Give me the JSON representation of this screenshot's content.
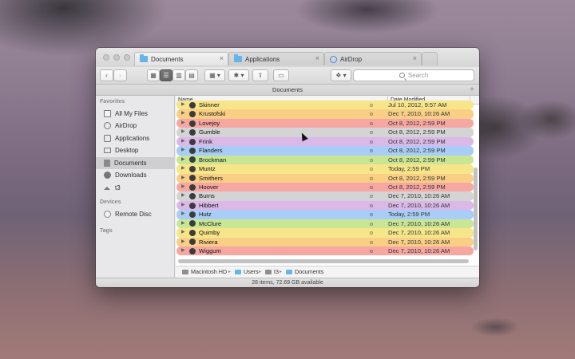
{
  "tabs": [
    {
      "label": "Documents",
      "icon": "folder-icon",
      "active": true
    },
    {
      "label": "Applications",
      "icon": "folder-icon",
      "active": false
    },
    {
      "label": "AirDrop",
      "icon": "airdrop-icon",
      "active": false
    }
  ],
  "toolbar": {
    "search_placeholder": "Search",
    "back_glyph": "‹",
    "forward_glyph": "›"
  },
  "path_header": {
    "title": "Documents"
  },
  "sidebar": {
    "favorites_label": "Favorites",
    "favorites": [
      {
        "label": "All My Files",
        "icon": "all-files-icon"
      },
      {
        "label": "AirDrop",
        "icon": "airdrop-icon"
      },
      {
        "label": "Applications",
        "icon": "applications-icon"
      },
      {
        "label": "Desktop",
        "icon": "desktop-icon"
      },
      {
        "label": "Documents",
        "icon": "documents-icon",
        "selected": true
      },
      {
        "label": "Downloads",
        "icon": "downloads-icon"
      },
      {
        "label": "t3",
        "icon": "home-icon"
      }
    ],
    "devices_label": "Devices",
    "devices": [
      {
        "label": "Remote Disc",
        "icon": "disc-icon"
      }
    ],
    "tags_label": "Tags"
  },
  "columns": {
    "name": "Name",
    "date": "Date Modified"
  },
  "files": [
    {
      "name": "Skinner",
      "date": "Jul 10, 2012, 9:57 AM",
      "color": "#f7e58a"
    },
    {
      "name": "Krustofski",
      "date": "Dec 7, 2010, 10:26 AM",
      "color": "#f9cf86"
    },
    {
      "name": "Lovejoy",
      "date": "Oct 8, 2012, 2:59 PM",
      "color": "#f7a7a1"
    },
    {
      "name": "Gumble",
      "date": "Oct 8, 2012, 2:59 PM",
      "color": "#d4d4d4"
    },
    {
      "name": "Frink",
      "date": "Oct 8, 2012, 2:59 PM",
      "color": "#dab8e8"
    },
    {
      "name": "Flanders",
      "date": "Oct 8, 2012, 2:59 PM",
      "color": "#a9cdf6"
    },
    {
      "name": "Brockman",
      "date": "Oct 8, 2012, 2:59 PM",
      "color": "#c9e694"
    },
    {
      "name": "Muntz",
      "date": "Today, 2:59 PM",
      "color": "#f7e58a"
    },
    {
      "name": "Smithers",
      "date": "Oct 8, 2012, 2:59 PM",
      "color": "#f9cf86"
    },
    {
      "name": "Hoover",
      "date": "Oct 8, 2012, 2:59 PM",
      "color": "#f7a7a1"
    },
    {
      "name": "Burns",
      "date": "Dec 7, 2010, 10:26 AM",
      "color": "#d4d4d4"
    },
    {
      "name": "Hibbert",
      "date": "Dec 7, 2010, 10:26 AM",
      "color": "#dab8e8"
    },
    {
      "name": "Hutz",
      "date": "Today, 2:59 PM",
      "color": "#a9cdf6"
    },
    {
      "name": "McClure",
      "date": "Dec 7, 2010, 10:26 AM",
      "color": "#c9e694"
    },
    {
      "name": "Quimby",
      "date": "Dec 7, 2010, 10:26 AM",
      "color": "#f7e58a"
    },
    {
      "name": "Riviera",
      "date": "Dec 7, 2010, 10:26 AM",
      "color": "#f9cf86"
    },
    {
      "name": "Wiggum",
      "date": "Dec 7, 2010, 10:26 AM",
      "color": "#f7a7a1"
    }
  ],
  "path_bar": [
    "Macintosh HD",
    "Users",
    "t3",
    "Documents"
  ],
  "status": {
    "text": "28 items, 72.69 GB available"
  }
}
